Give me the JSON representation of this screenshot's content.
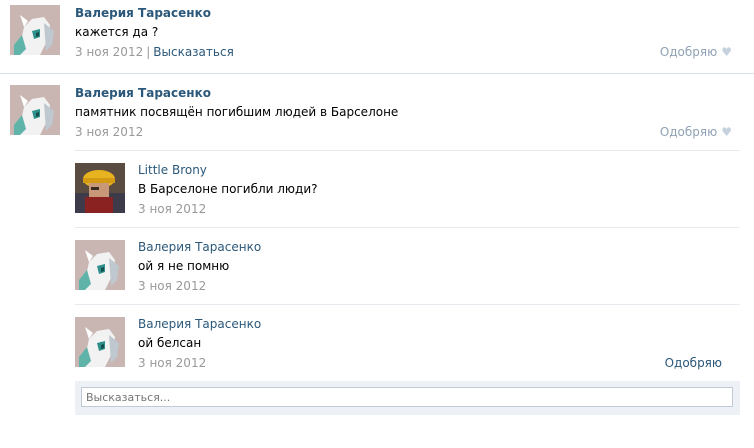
{
  "posts": [
    {
      "author": "Валерия Тарасенко",
      "text": "кажется да ?",
      "date": "3 ноя 2012",
      "reply_link": "Высказаться",
      "like_label": "Одобряю"
    },
    {
      "author": "Валерия Тарасенко",
      "text": "памятник посвящён погибшим людей в Барселоне",
      "date": "3 ноя 2012",
      "like_label": "Одобряю",
      "replies": [
        {
          "author": "Little Brony",
          "text": "В Барселоне погибли люди?",
          "date": "3 ноя 2012"
        },
        {
          "author": "Валерия Тарасенко",
          "text": "ой я не помню",
          "date": "3 ноя 2012"
        },
        {
          "author": "Валерия Тарасенко",
          "text": "ой белсан",
          "date": "3 ноя 2012",
          "like_label": "Одобряю"
        }
      ],
      "reply_placeholder": "Высказаться..."
    }
  ],
  "icons": {
    "like": "heart-icon"
  },
  "colors": {
    "link": "#2b587a",
    "muted": "#999999",
    "divider": "#dae1e8",
    "reply_box_bg": "#edf1f5"
  }
}
